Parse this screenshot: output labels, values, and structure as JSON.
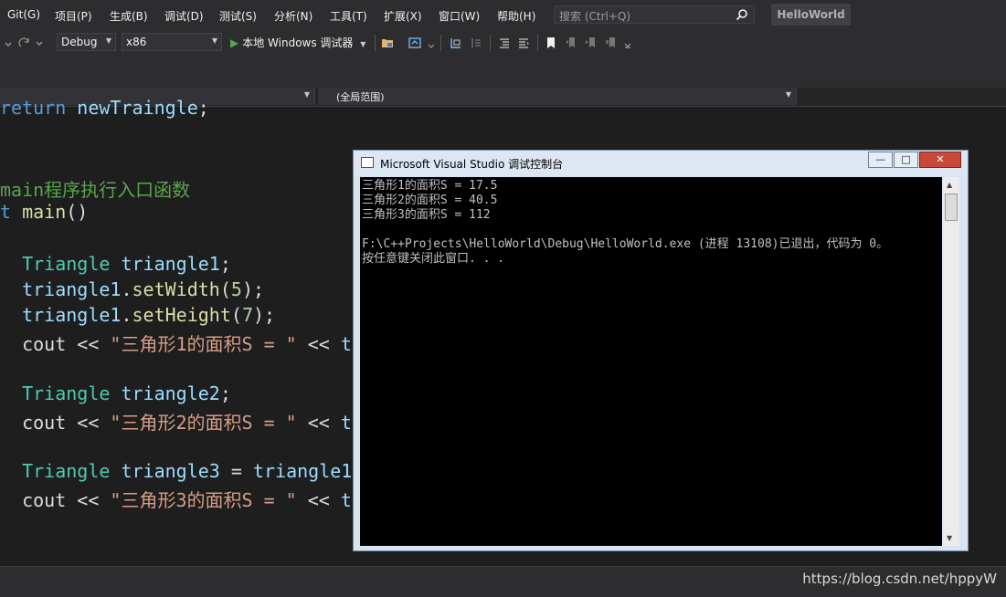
{
  "menu": [
    "Git(G)",
    "项目(P)",
    "生成(B)",
    "调试(D)",
    "测试(S)",
    "分析(N)",
    "工具(T)",
    "扩展(X)",
    "窗口(W)",
    "帮助(H)"
  ],
  "search": {
    "placeholder": "搜索 (Ctrl+Q)"
  },
  "app_title": "HelloWorld",
  "toolbar": {
    "config": "Debug",
    "platform": "x86",
    "run_label": "本地 Windows 调试器"
  },
  "navbar": {
    "scope": "(全局范围)"
  },
  "editor": {
    "lines": [
      [
        [
          "kw",
          "return"
        ],
        [
          "op",
          " "
        ],
        [
          "var",
          "newTraingle"
        ],
        [
          "op",
          ";"
        ]
      ],
      [],
      [
        [
          "cmt",
          "main程序执行入口函数"
        ]
      ],
      [
        [
          "kw",
          "t"
        ],
        [
          "op",
          " "
        ],
        [
          "fn",
          "main"
        ],
        [
          "op",
          "()"
        ]
      ],
      [],
      [
        [
          "op",
          "  "
        ],
        [
          "type",
          "Triangle"
        ],
        [
          "op",
          " "
        ],
        [
          "var",
          "triangle1"
        ],
        [
          "op",
          ";"
        ]
      ],
      [
        [
          "op",
          "  "
        ],
        [
          "var",
          "triangle1"
        ],
        [
          "op",
          "."
        ],
        [
          "fn",
          "setWidth"
        ],
        [
          "op",
          "("
        ],
        [
          "num",
          "5"
        ],
        [
          "op",
          ");"
        ]
      ],
      [
        [
          "op",
          "  "
        ],
        [
          "var",
          "triangle1"
        ],
        [
          "op",
          "."
        ],
        [
          "fn",
          "setHeight"
        ],
        [
          "op",
          "("
        ],
        [
          "num",
          "7"
        ],
        [
          "op",
          ");"
        ]
      ],
      [
        [
          "op",
          "  cout << "
        ],
        [
          "str",
          "\"三角形1的面积S = \""
        ],
        [
          "op",
          " << "
        ],
        [
          "var",
          "t"
        ]
      ],
      [],
      [
        [
          "op",
          "  "
        ],
        [
          "type",
          "Triangle"
        ],
        [
          "op",
          " "
        ],
        [
          "var",
          "triangle2"
        ],
        [
          "op",
          ";"
        ]
      ],
      [
        [
          "op",
          "  cout << "
        ],
        [
          "str",
          "\"三角形2的面积S = \""
        ],
        [
          "op",
          " << "
        ],
        [
          "var",
          "t"
        ]
      ],
      [],
      [
        [
          "op",
          "  "
        ],
        [
          "type",
          "Triangle"
        ],
        [
          "op",
          " "
        ],
        [
          "var",
          "triangle3"
        ],
        [
          "op",
          " = "
        ],
        [
          "var",
          "triangle1"
        ]
      ],
      [
        [
          "op",
          "  cout << "
        ],
        [
          "str",
          "\"三角形3的面积S = \""
        ],
        [
          "op",
          " << "
        ],
        [
          "var",
          "t"
        ]
      ]
    ]
  },
  "console": {
    "title": "Microsoft Visual Studio 调试控制台",
    "buttons": {
      "minimize": "—",
      "maximize": "□",
      "close": "✕"
    },
    "output": [
      "三角形1的面积S = 17.5",
      "三角形2的面积S = 40.5",
      "三角形3的面积S = 112",
      "",
      "F:\\C++Projects\\HelloWorld\\Debug\\HelloWorld.exe (进程 13108)已退出，代码为 0。",
      "按任意键关闭此窗口. . ."
    ]
  },
  "watermark": "https://blog.csdn.net/hppyW",
  "colors": {
    "accent_play": "#57a64a",
    "close_button": "#c8483a",
    "console_bg": "#000000"
  }
}
